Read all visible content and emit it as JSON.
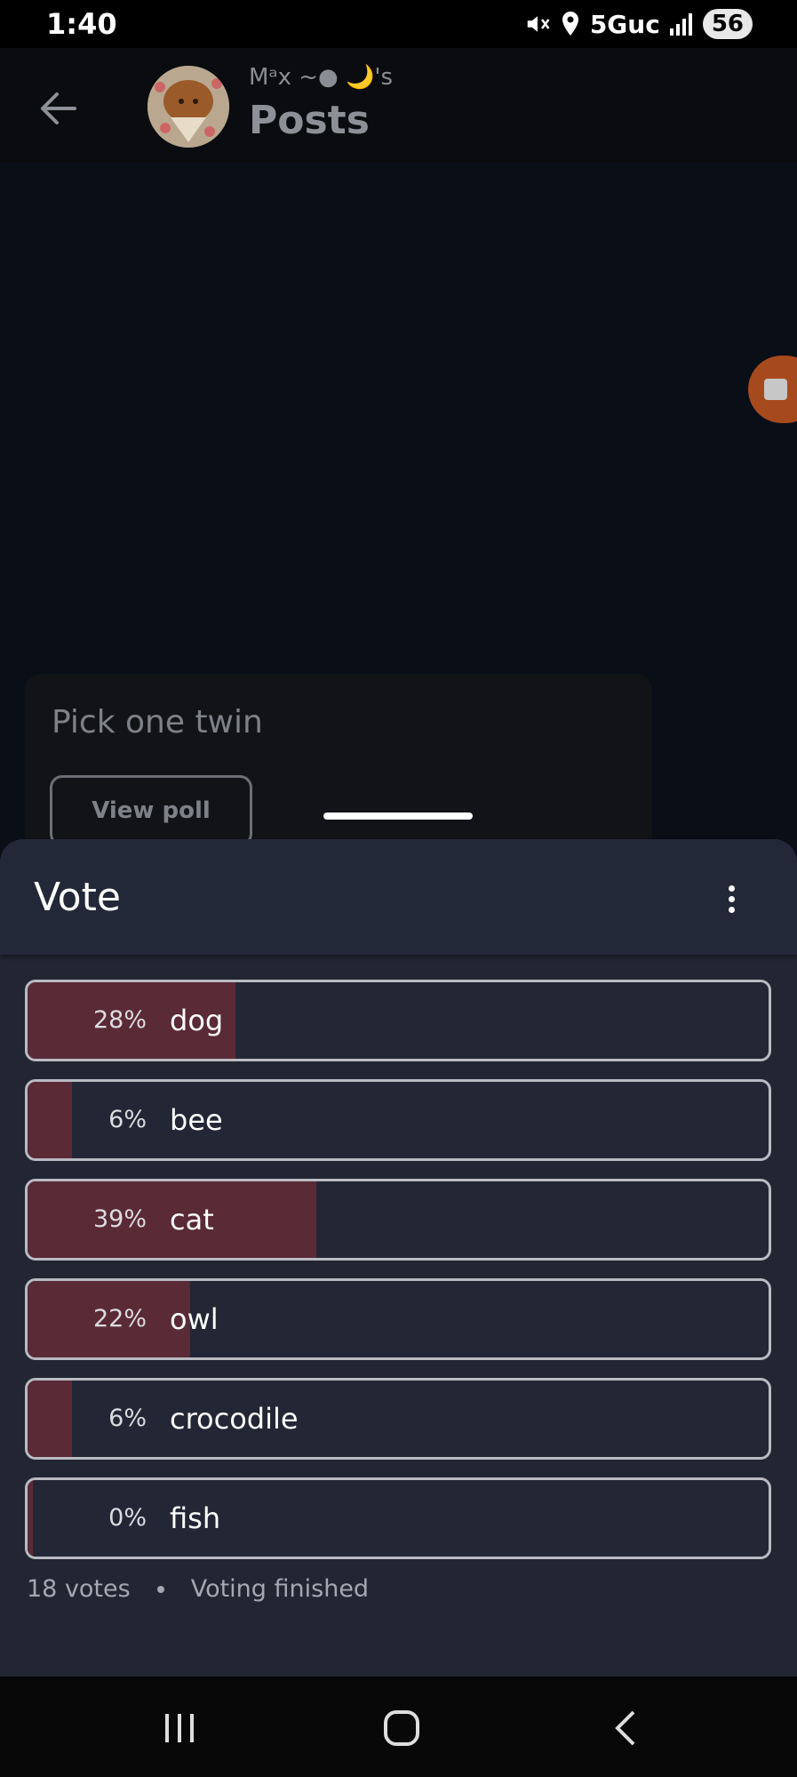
{
  "status_bar": {
    "time": "1:40",
    "network": "5Guc",
    "battery": "56"
  },
  "header": {
    "subtitle": "Mᵃx ~● 🌙's",
    "title": "Posts"
  },
  "post": {
    "title": "Pick one twin",
    "view_poll_label": "View poll"
  },
  "sheet": {
    "title": "Vote",
    "options": [
      {
        "percent_label": "28%",
        "label": "dog",
        "fraction": 0.28
      },
      {
        "percent_label": "6%",
        "label": "bee",
        "fraction": 0.06
      },
      {
        "percent_label": "39%",
        "label": "cat",
        "fraction": 0.39
      },
      {
        "percent_label": "22%",
        "label": "owl",
        "fraction": 0.22
      },
      {
        "percent_label": "6%",
        "label": "crocodile",
        "fraction": 0.06
      },
      {
        "percent_label": "0%",
        "label": "fish",
        "fraction": 0.0
      }
    ],
    "votes": "18 votes",
    "status": "Voting finished"
  },
  "colors": {
    "bar_fill": "#5a2a37",
    "sheet_bg": "#222633",
    "accent_orange": "#a64a1e"
  },
  "icons": {
    "back": "arrow-left-icon",
    "more": "more-vertical-icon",
    "nav_recent": "recent-apps-icon",
    "nav_home": "home-icon",
    "nav_back": "back-chevron-icon"
  }
}
